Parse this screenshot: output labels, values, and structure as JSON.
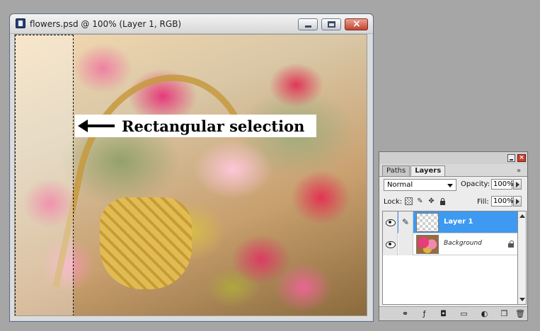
{
  "document": {
    "title": "flowers.psd @ 100% (Layer 1, RGB)",
    "window_buttons": {
      "minimize": "minimize-icon",
      "maximize": "maximize-icon",
      "close": "close-icon",
      "close_glyph": "×"
    }
  },
  "annotation": {
    "text": "Rectangular selection",
    "arrow": "left-arrow-icon"
  },
  "palette": {
    "close_glyph": "×",
    "tabs": [
      {
        "label": "Paths",
        "active": false
      },
      {
        "label": "Layers",
        "active": true
      }
    ],
    "more": "»",
    "blend_mode": "Normal",
    "opacity_label": "Opacity:",
    "opacity_value": "100%",
    "lock_label": "Lock:",
    "fill_label": "Fill:",
    "fill_value": "100%",
    "layers": [
      {
        "name": "Layer 1",
        "selected": true,
        "thumbnail": "transparent"
      },
      {
        "name": "Background",
        "selected": false,
        "thumbnail": "flowers",
        "locked": true
      }
    ],
    "brush_glyph": "✎",
    "bottom_icons": [
      "link-layers-icon",
      "layer-style-icon",
      "layer-mask-icon",
      "new-group-icon",
      "adjustment-layer-icon",
      "new-layer-icon",
      "trash-icon"
    ],
    "bottom_glyphs": [
      "⚭",
      "ƒ",
      "◘",
      "▭",
      "◐",
      "❐",
      "🗑"
    ]
  },
  "colors": {
    "selection_highlight": "#3d9af0",
    "close_button": "#c3422e"
  }
}
